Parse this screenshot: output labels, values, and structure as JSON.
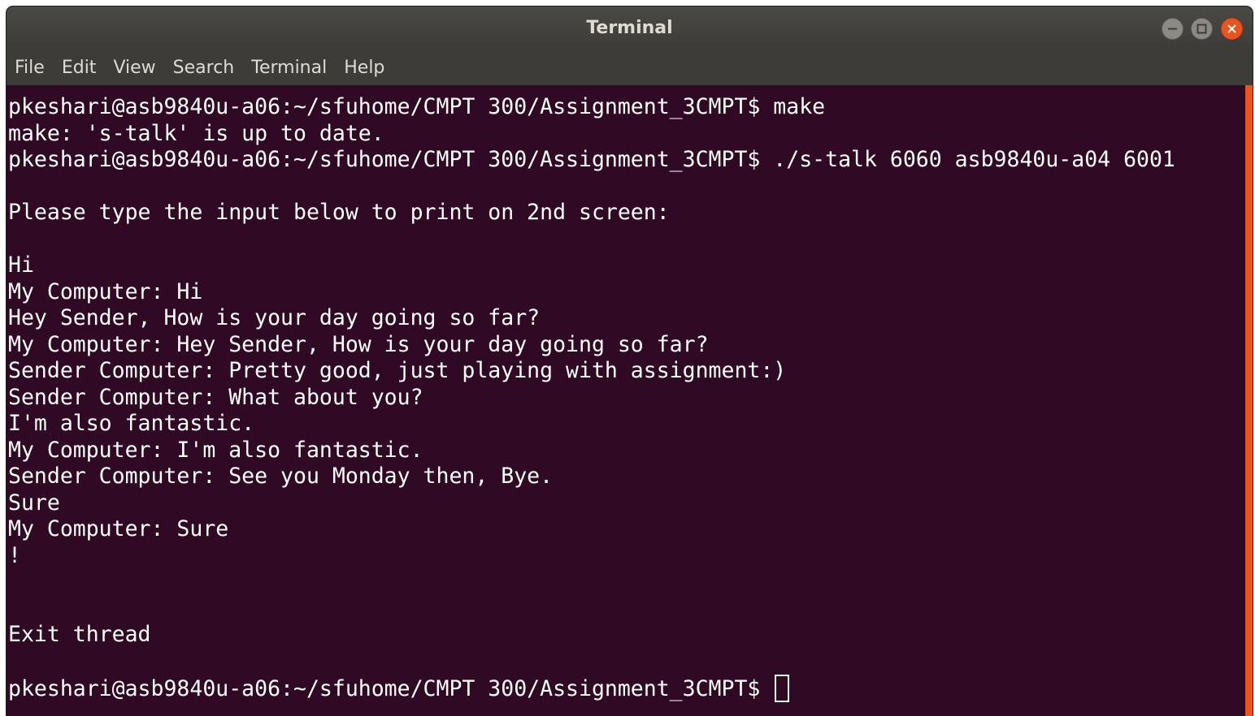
{
  "window": {
    "title": "Terminal"
  },
  "menu": {
    "items": [
      "File",
      "Edit",
      "View",
      "Search",
      "Terminal",
      "Help"
    ]
  },
  "terminal": {
    "lines": [
      "pkeshari@asb9840u-a06:~/sfuhome/CMPT 300/Assignment_3CMPT$ make",
      "make: 's-talk' is up to date.",
      "pkeshari@asb9840u-a06:~/sfuhome/CMPT 300/Assignment_3CMPT$ ./s-talk 6060 asb9840u-a04 6001",
      "",
      "Please type the input below to print on 2nd screen:",
      "",
      "Hi",
      "My Computer: Hi",
      "Hey Sender, How is your day going so far?",
      "My Computer: Hey Sender, How is your day going so far?",
      "Sender Computer: Pretty good, just playing with assignment:)",
      "Sender Computer: What about you?",
      "I'm also fantastic.",
      "My Computer: I'm also fantastic.",
      "Sender Computer: See you Monday then, Bye.",
      "Sure",
      "My Computer: Sure",
      "!",
      "",
      "",
      "Exit thread",
      "",
      "pkeshari@asb9840u-a06:~/sfuhome/CMPT 300/Assignment_3CMPT$ "
    ]
  },
  "colors": {
    "background": "#300a24",
    "foreground": "#ffffff",
    "accent": "#e95420",
    "titlebar": "#3d3c38"
  },
  "icons": {
    "minimize": "minimize-icon",
    "maximize": "maximize-icon",
    "close": "close-icon"
  }
}
